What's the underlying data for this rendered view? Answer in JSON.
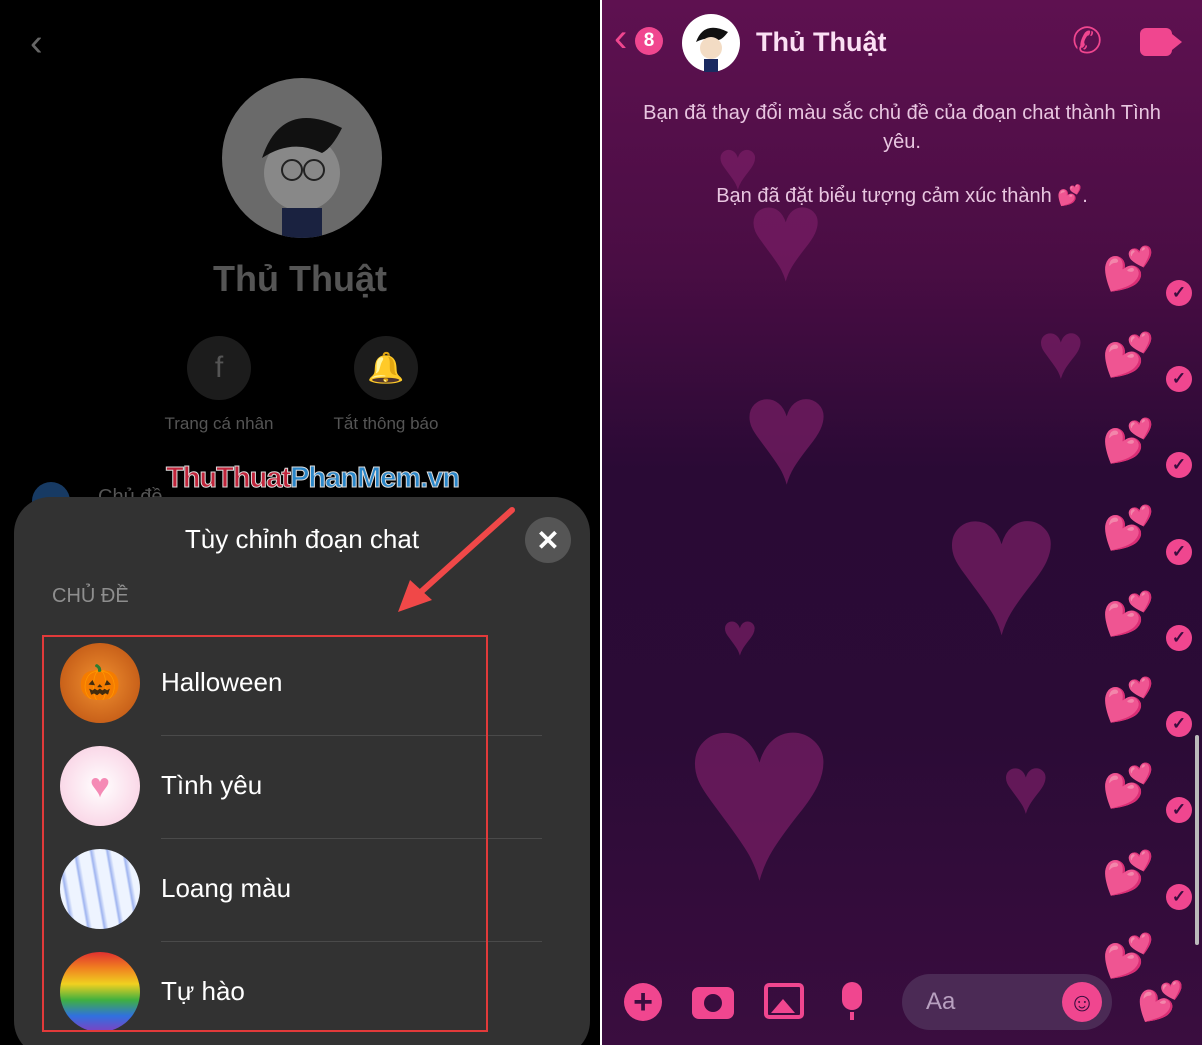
{
  "profile": {
    "back_icon": "chevron-left-icon",
    "name": "Thủ Thuật",
    "actions": [
      {
        "icon": "facebook-icon",
        "label": "Trang cá nhân"
      },
      {
        "icon": "bell-icon",
        "label": "Tắt thông báo"
      }
    ],
    "hidden_row": "Chủ đề"
  },
  "watermark": {
    "part1": "ThuThuat",
    "part2": "PhanMem",
    "part3": ".vn"
  },
  "sheet": {
    "title": "Tùy chỉnh đoạn chat",
    "close_icon": "close-icon",
    "section": "CHỦ ĐỀ",
    "themes": [
      {
        "label": "Halloween",
        "icon": "pumpkin-icon"
      },
      {
        "label": "Tình yêu",
        "icon": "hearts-icon"
      },
      {
        "label": "Loang màu",
        "icon": "tie-dye-icon"
      },
      {
        "label": "Tự hào",
        "icon": "rainbow-icon"
      }
    ]
  },
  "chat": {
    "unread_count": "8",
    "name": "Thủ Thuật",
    "system_messages": [
      "Bạn đã thay đổi màu sắc chủ đề của đoạn chat thành Tình yêu.",
      "Bạn đã đặt biểu tượng cảm xúc thành 💕."
    ],
    "message_emoji": "💕",
    "input_placeholder": "Aa"
  },
  "colors": {
    "accent": "#f0468f",
    "annotation": "#e23a3a"
  }
}
